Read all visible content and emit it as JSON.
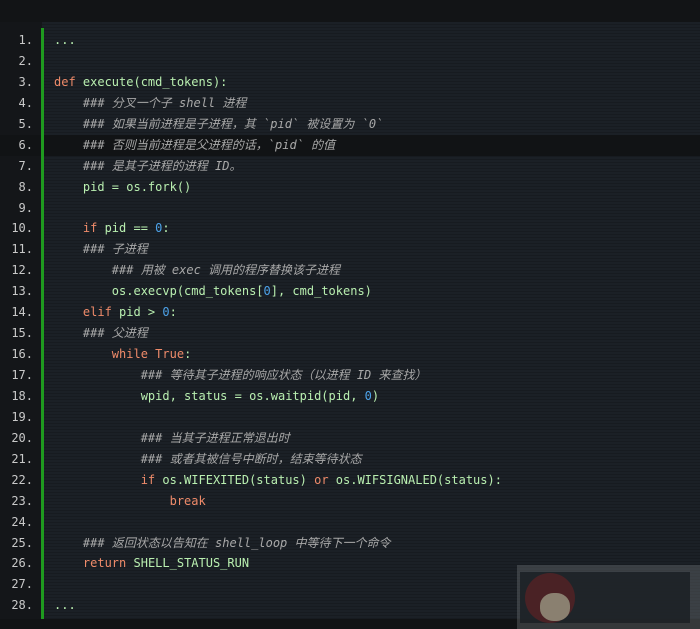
{
  "editor": {
    "highlighted_line": 6,
    "colors": {
      "keyword": "#ef8b6a",
      "number": "#4da3ea",
      "comment": "#a8a8a8",
      "text": "#b9efb0",
      "gutter_bar": "#1f9a1f"
    },
    "lines": [
      [
        [
          "t",
          "..."
        ]
      ],
      [],
      [
        [
          "kw",
          "def"
        ],
        [
          "t",
          " execute(cmd_tokens):"
        ]
      ],
      [
        [
          "t",
          "    "
        ],
        [
          "cm",
          "### 分叉一个子 shell 进程"
        ]
      ],
      [
        [
          "t",
          "    "
        ],
        [
          "cm",
          "### 如果当前进程是子进程，其 `pid` 被设置为 `0`"
        ]
      ],
      [
        [
          "t",
          "    "
        ],
        [
          "cm",
          "### 否则当前进程是父进程的话，`pid` 的值"
        ]
      ],
      [
        [
          "t",
          "    "
        ],
        [
          "cm",
          "### 是其子进程的进程 ID。"
        ]
      ],
      [
        [
          "t",
          "    pid = os.fork()"
        ]
      ],
      [],
      [
        [
          "t",
          "    "
        ],
        [
          "kw",
          "if"
        ],
        [
          "t",
          " pid == "
        ],
        [
          "num",
          "0"
        ],
        [
          "t",
          ":"
        ]
      ],
      [
        [
          "t",
          "    "
        ],
        [
          "cm",
          "### 子进程"
        ]
      ],
      [
        [
          "t",
          "        "
        ],
        [
          "cm",
          "### 用被 exec 调用的程序替换该子进程"
        ]
      ],
      [
        [
          "t",
          "        os.execvp(cmd_tokens["
        ],
        [
          "num",
          "0"
        ],
        [
          "t",
          "], cmd_tokens)"
        ]
      ],
      [
        [
          "t",
          "    "
        ],
        [
          "kw",
          "elif"
        ],
        [
          "t",
          " pid > "
        ],
        [
          "num",
          "0"
        ],
        [
          "t",
          ":"
        ]
      ],
      [
        [
          "t",
          "    "
        ],
        [
          "cm",
          "### 父进程"
        ]
      ],
      [
        [
          "t",
          "        "
        ],
        [
          "kw",
          "while"
        ],
        [
          "t",
          " "
        ],
        [
          "kw",
          "True"
        ],
        [
          "t",
          ":"
        ]
      ],
      [
        [
          "t",
          "            "
        ],
        [
          "cm",
          "### 等待其子进程的响应状态（以进程 ID 来查找）"
        ]
      ],
      [
        [
          "t",
          "            wpid, status = os.waitpid(pid, "
        ],
        [
          "num",
          "0"
        ],
        [
          "t",
          ")"
        ]
      ],
      [],
      [
        [
          "t",
          "            "
        ],
        [
          "cm",
          "### 当其子进程正常退出时"
        ]
      ],
      [
        [
          "t",
          "            "
        ],
        [
          "cm",
          "### 或者其被信号中断时，结束等待状态"
        ]
      ],
      [
        [
          "t",
          "            "
        ],
        [
          "kw",
          "if"
        ],
        [
          "t",
          " os.WIFEXITED(status) "
        ],
        [
          "kw",
          "or"
        ],
        [
          "t",
          " os.WIFSIGNALED(status):"
        ]
      ],
      [
        [
          "t",
          "                "
        ],
        [
          "kw",
          "break"
        ]
      ],
      [],
      [
        [
          "t",
          "    "
        ],
        [
          "cm",
          "### 返回状态以告知在 shell_loop 中等待下一个命令"
        ]
      ],
      [
        [
          "t",
          "    "
        ],
        [
          "kw",
          "return"
        ],
        [
          "t",
          " SHELL_STATUS_RUN"
        ]
      ],
      [],
      [
        [
          "t",
          "..."
        ]
      ]
    ]
  }
}
